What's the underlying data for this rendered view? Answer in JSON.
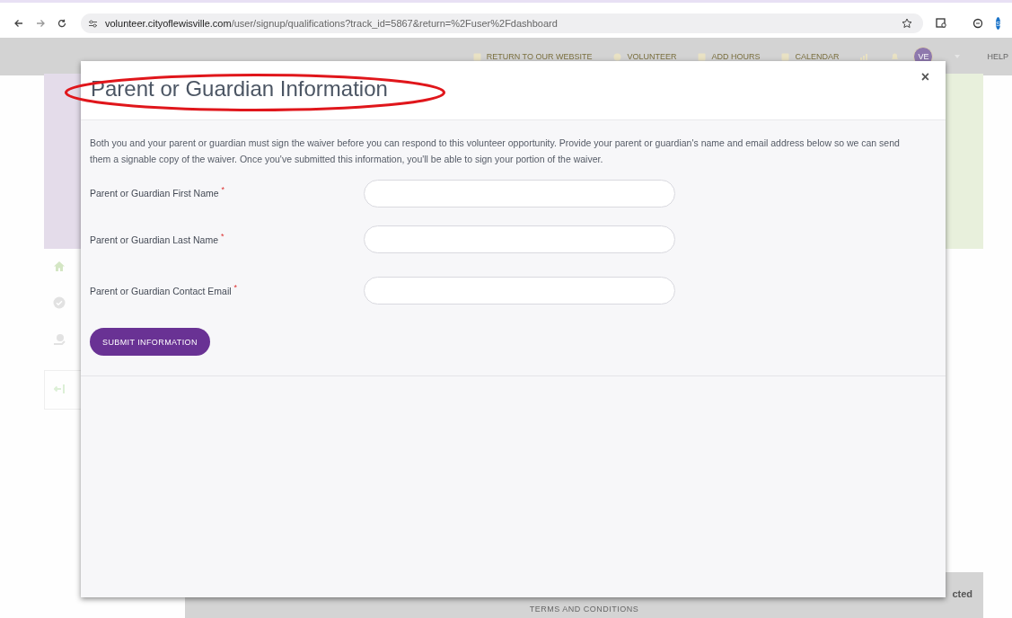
{
  "browser": {
    "url_host": "volunteer.cityoflewisville.com",
    "url_path": "/user/signup/qualifications?track_id=5867&return=%2Fuser%2Fdashboard",
    "profile_initial": "S"
  },
  "nav": {
    "items": [
      {
        "kind": "link",
        "label": "RETURN TO OUR WEBSITE"
      },
      {
        "kind": "link",
        "label": "VOLUNTEER"
      },
      {
        "kind": "link",
        "label": "ADD HOURS"
      },
      {
        "kind": "link",
        "label": "CALENDAR"
      }
    ],
    "avatar": "VE",
    "help": "HELP"
  },
  "modal": {
    "title": "Parent or Guardian Information",
    "close": "×",
    "highlighted": true,
    "intro": "Both you and your parent or guardian must sign the waiver before you can respond to this volunteer opportunity. Provide your parent or guardian's name and email address below so we can send them a signable copy of the waiver. Once you've submitted this information, you'll be able to sign your portion of the waiver.",
    "fields": [
      {
        "label": "Parent or Guardian First Name",
        "required_mark": "*"
      },
      {
        "label": "Parent or Guardian Last Name",
        "required_mark": "*"
      },
      {
        "label": "Parent or Guardian Contact Email",
        "required_mark": "*"
      }
    ],
    "submit": "SUBMIT INFORMATION"
  },
  "footer": {
    "link": "TERMS AND CONDITIONS",
    "brand": "cted"
  }
}
